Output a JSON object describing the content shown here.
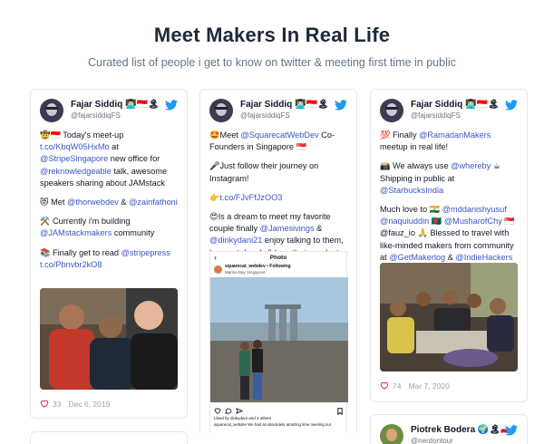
{
  "header": {
    "title": "Meet Makers In Real Life",
    "subtitle": "Curated list of people i get to know on twitter & meeting first time in public"
  },
  "cards": [
    {
      "author": {
        "name": "Fajar Siddiq 👨🏻‍💻🇮🇩🏝",
        "handle": "@fajarsiddiqFS"
      },
      "paragraphs": [
        [
          {
            "t": "🤠🇮🇩 Today's meet-up "
          },
          {
            "l": "t.co/KbqW05HxMo"
          },
          {
            "t": " at "
          },
          {
            "l": "@StripeSingapore"
          },
          {
            "t": " new office for "
          },
          {
            "l": "@reknowledgeable"
          },
          {
            "t": " talk, awesome speakers sharing about JAMstack"
          }
        ],
        [
          {
            "t": "😻 Met "
          },
          {
            "l": "@thorwebdev"
          },
          {
            "t": " & "
          },
          {
            "l": "@zainfathoni"
          }
        ],
        [
          {
            "t": "⚒️ Currently i'm building "
          },
          {
            "l": "@JAMstackmakers"
          },
          {
            "t": " community"
          }
        ],
        [
          {
            "t": "📚 Finally get to read "
          },
          {
            "l": "@stripepress"
          },
          {
            "t": " "
          },
          {
            "l": "t.co/Pbnvbr2kO8"
          }
        ]
      ],
      "likes": "33",
      "date": "Dec 6, 2019"
    },
    {
      "author": {
        "name": "Fajar Siddiq 👨🏻‍💻🇮🇩🏝",
        "handle": "@fajarsiddiqFS"
      },
      "paragraphs": [
        [
          {
            "t": "🤩Meet "
          },
          {
            "l": "@SquarecatWebDev"
          },
          {
            "t": " Co-Founders in Singapore 🇸🇬"
          }
        ],
        [
          {
            "t": "🎤Just follow their journey on Instagram!"
          }
        ],
        [
          {
            "t": "👉"
          },
          {
            "l": "t.co/FJvFfJzOO3"
          }
        ],
        [
          {
            "t": "😍Is a dream to meet my favorite couple finally "
          },
          {
            "l": "@Jamesivings"
          },
          {
            "t": " & "
          },
          {
            "l": "@dinkydani21"
          },
          {
            "t": " enjoy talking to them, hangout, laugh & love their product and blog updates! "
          },
          {
            "l": "t.co/u78DOr0w0W"
          }
        ]
      ],
      "embed": {
        "header": "Photo",
        "account": "squarecat_webdev • Following",
        "location": "Marina Bay Singapore",
        "liked_by": "Liked by dinkydani and 3 others",
        "caption": "squarecat_webdev We had an absolutely amazing time meeting our"
      }
    },
    {
      "author": {
        "name": "Fajar Siddiq 👨🏻‍💻🇮🇩🏝",
        "handle": "@fajarsiddiqFS"
      },
      "paragraphs": [
        [
          {
            "t": "💯 Finally "
          },
          {
            "l": "@RamadanMakers"
          },
          {
            "t": " meetup in real life!"
          }
        ],
        [
          {
            "t": "📸 We always use "
          },
          {
            "l": "@whereby"
          },
          {
            "t": " ☕ Shipping in public at "
          },
          {
            "l": "@StarbucksIndia"
          }
        ],
        [
          {
            "t": "Much love to 🇮🇳 "
          },
          {
            "l": "@mddanishyusuf"
          },
          {
            "t": " "
          },
          {
            "l": "@naquiuddin"
          },
          {
            "t": " 🇧🇩 "
          },
          {
            "l": "@MusharofChy"
          },
          {
            "t": " 🇸🇬 @fauz_io 🙏 Blessed to travel with like-minded makers from community at "
          },
          {
            "l": "@GetMakerlog"
          },
          {
            "t": " & "
          },
          {
            "l": "@IndieHackers"
          },
          {
            "t": " "
          },
          {
            "l": "t.co/lmJZzsMPuV"
          }
        ]
      ],
      "likes": "74",
      "date": "Mar 7, 2020"
    },
    {
      "author": {
        "name": "Piotrek Bodera 🌍🏝🇵🇱",
        "handle": "@nerdontour"
      }
    }
  ],
  "colors": {
    "link": "#3b56c4",
    "twitter": "#1d9bf0",
    "title": "#1e293b"
  }
}
